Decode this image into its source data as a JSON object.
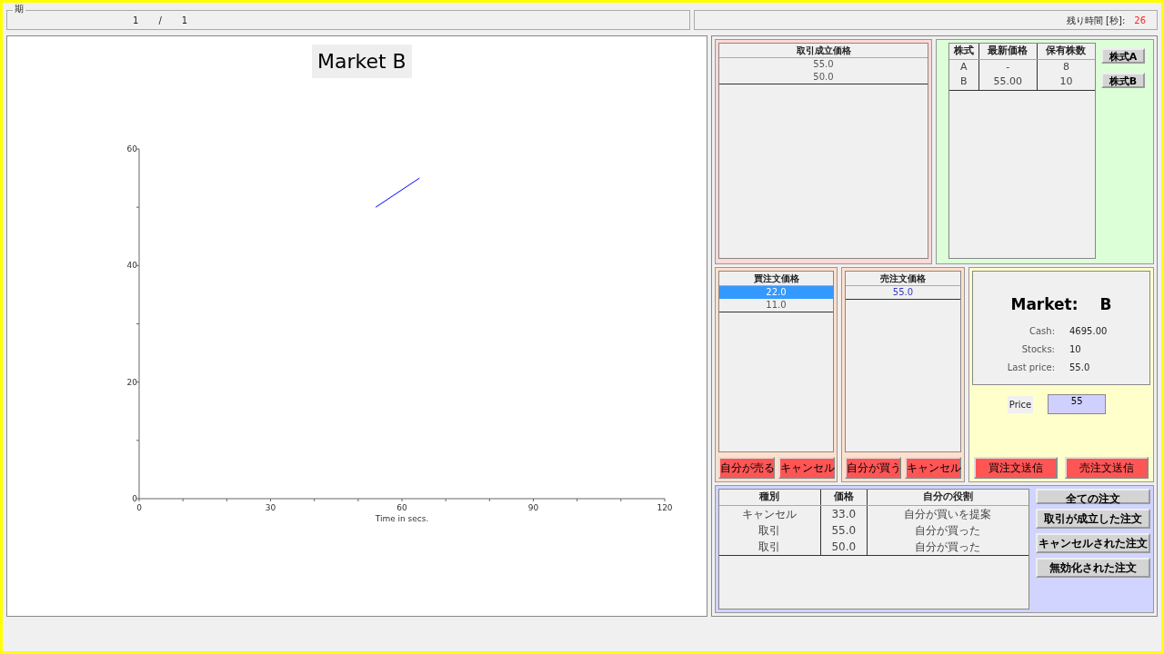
{
  "period": {
    "legend": "期",
    "current": "1",
    "separator": "/",
    "total": "1"
  },
  "timer": {
    "label": "残り時間 [秒]:",
    "value": "26"
  },
  "chart": {
    "title": "Market B",
    "chart_data": {
      "type": "line",
      "xlabel": "Time in secs.",
      "x": [
        54,
        64
      ],
      "series": [
        {
          "color": "#0000ff",
          "values": [
            50,
            55
          ]
        }
      ],
      "xlim": [
        0,
        120
      ],
      "ylim": [
        0,
        60
      ],
      "xticks": [
        0,
        30,
        60,
        90,
        120
      ],
      "yticks": [
        0,
        20,
        40,
        60
      ]
    }
  },
  "trade_prices": {
    "header": "取引成立価格",
    "rows": [
      "55.0",
      "50.0"
    ]
  },
  "stocks": {
    "columns": [
      "株式",
      "最新価格",
      "保有株数"
    ],
    "rows": [
      [
        "A",
        "-",
        "8"
      ],
      [
        "B",
        "55.00",
        "10"
      ]
    ],
    "buttons": [
      "株式A",
      "株式B"
    ]
  },
  "buy_orders": {
    "header": "買注文価格",
    "rows": [
      {
        "price": "22.0",
        "selected": true
      },
      {
        "price": "11.0",
        "selected": false
      }
    ],
    "buttons": [
      "自分が売る",
      "キャンセル"
    ]
  },
  "sell_orders": {
    "header": "売注文価格",
    "rows": [
      {
        "price": "55.0",
        "selected": false
      }
    ],
    "buttons": [
      "自分が買う",
      "キャンセル"
    ]
  },
  "market": {
    "label": "Market:",
    "name": "B",
    "fields": [
      {
        "label": "Cash:",
        "value": "4695.00"
      },
      {
        "label": "Stocks:",
        "value": "10"
      },
      {
        "label": "Last price:",
        "value": "55.0"
      }
    ]
  },
  "order_entry": {
    "price_label": "Price",
    "price_value": "55",
    "buttons": [
      "買注文送信",
      "売注文送信"
    ]
  },
  "history": {
    "columns": [
      "種別",
      "価格",
      "自分の役割"
    ],
    "rows": [
      [
        "キャンセル",
        "33.0",
        "自分が買いを提案"
      ],
      [
        "取引",
        "55.0",
        "自分が買った"
      ],
      [
        "取引",
        "50.0",
        "自分が買った"
      ]
    ],
    "filters": [
      "全ての注文",
      "取引が成立した注文",
      "キャンセルされた注文",
      "無効化された注文"
    ]
  }
}
